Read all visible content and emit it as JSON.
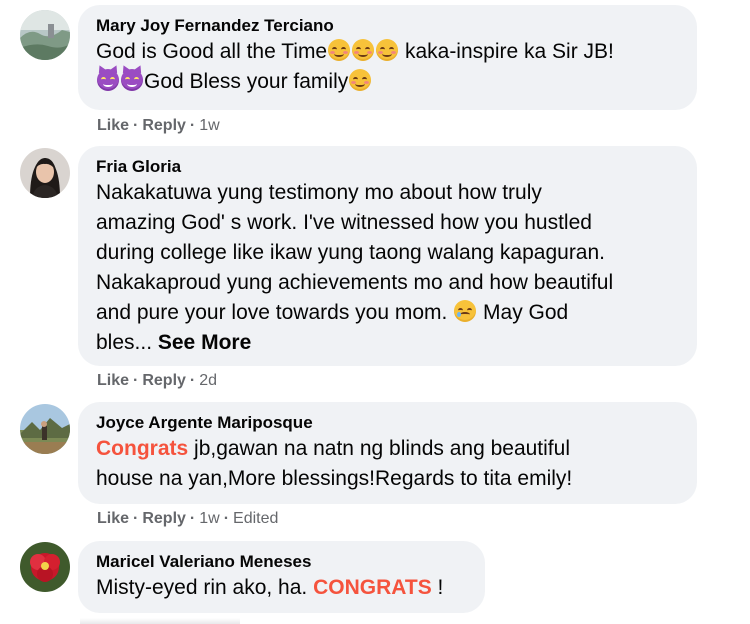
{
  "comments": [
    {
      "author": "Mary Joy Fernandez Terciano",
      "avatar_icon": "avatar-photo-landscape",
      "lines": [
        {
          "before": "God is Good all the Time",
          "after": " kaka-inspire ka Sir JB!"
        },
        {
          "before": "",
          "after": "God Bless your family"
        }
      ],
      "actions": {
        "like": "Like",
        "reply": "Reply",
        "time": "1w",
        "edited": ""
      }
    },
    {
      "author": "Fria Gloria",
      "avatar_icon": "avatar-photo-woman",
      "lines": [
        "Nakakatuwa yung testimony mo about how truly",
        "amazing God' s work. I've witnessed how you hustled",
        "during college like ikaw yung taong walang kapaguran.",
        "Nakakaproud yung achievements mo and how beautiful",
        "and pure your love towards you mom.",
        " May God",
        "bles...",
        "See More"
      ],
      "actions": {
        "like": "Like",
        "reply": "Reply",
        "time": "2d",
        "edited": ""
      }
    },
    {
      "author": "Joyce Argente Mariposque",
      "avatar_icon": "avatar-photo-outdoor",
      "highlight": "Congrats",
      "lines": [
        " jb,gawan na natn ng blinds ang beautiful",
        "house na yan,More blessings!Regards to tita emily!"
      ],
      "actions": {
        "like": "Like",
        "reply": "Reply",
        "time": "1w",
        "edited": "Edited"
      }
    },
    {
      "author": "Maricel Valeriano Meneses",
      "avatar_icon": "avatar-photo-flower",
      "text_before": "Misty-eyed rin ako, ha. ",
      "highlight": "CONGRATS",
      "text_after": " !"
    }
  ],
  "colors": {
    "bubble": "#f0f2f5",
    "highlight": "#f5533d",
    "meta": "#65676b"
  }
}
